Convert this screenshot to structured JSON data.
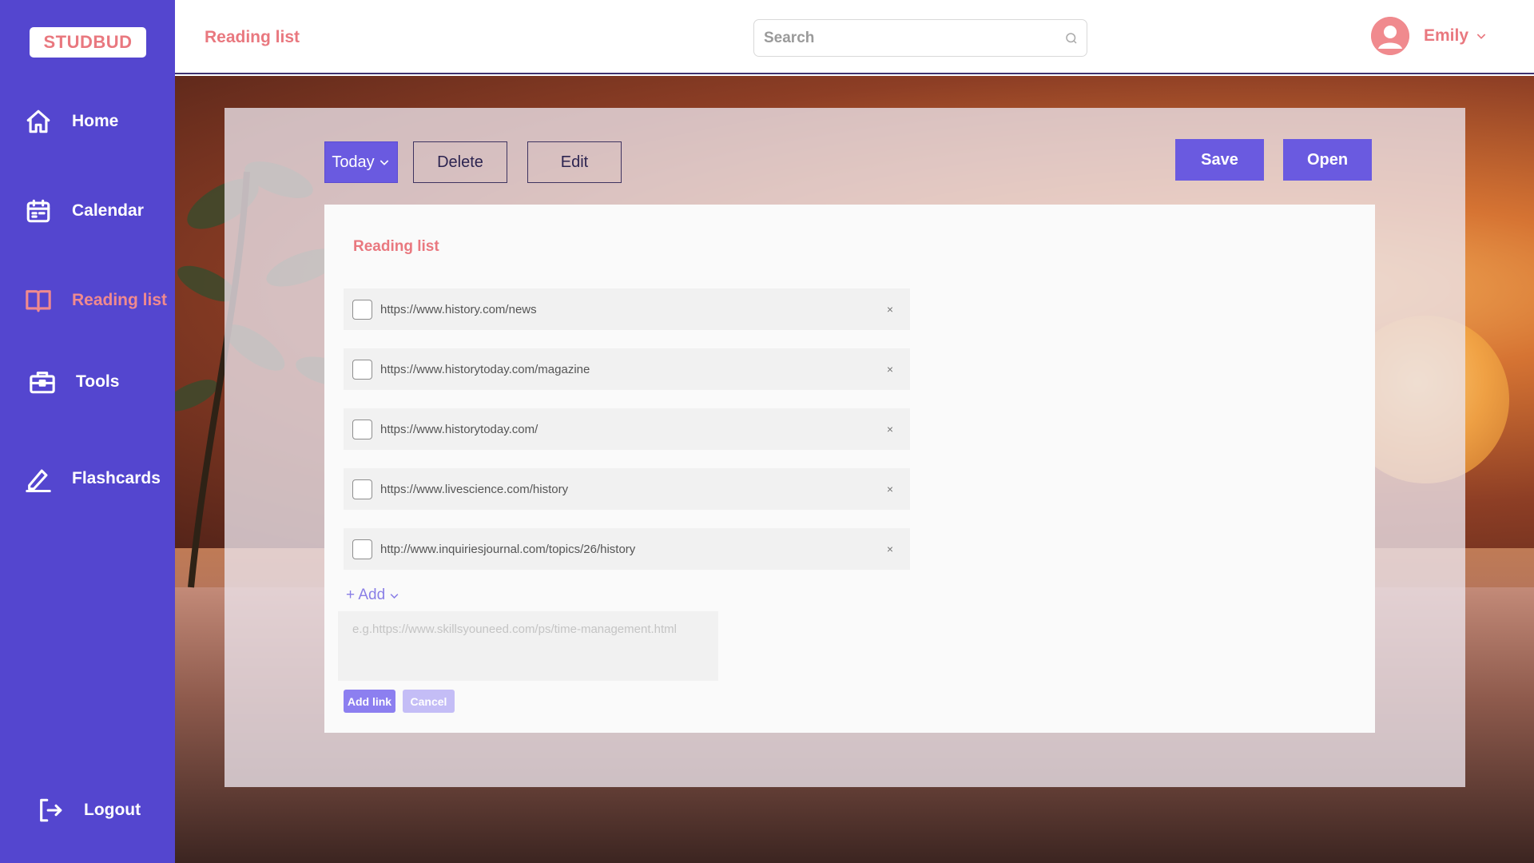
{
  "app": {
    "logo": "STUDBUD"
  },
  "sidebar": {
    "items": [
      {
        "label": "Home",
        "icon": "home-icon"
      },
      {
        "label": "Calendar",
        "icon": "calendar-icon"
      },
      {
        "label": "Reading list",
        "icon": "book-icon",
        "active": true
      },
      {
        "label": "Tools",
        "icon": "toolbox-icon"
      },
      {
        "label": "Flashcards",
        "icon": "pencil-icon"
      }
    ],
    "logout": {
      "label": "Logout",
      "icon": "logout-icon"
    }
  },
  "header": {
    "title": "Reading list",
    "search_placeholder": "Search",
    "user_name": "Emily"
  },
  "toolbar": {
    "today_label": "Today",
    "delete_label": "Delete",
    "edit_label": "Edit",
    "save_label": "Save",
    "open_label": "Open"
  },
  "card": {
    "title": "Reading list",
    "links": [
      {
        "url": "https://www.history.com/news",
        "checked": false
      },
      {
        "url": "https://www.historytoday.com/magazine",
        "checked": false
      },
      {
        "url": "https://www.historytoday.com/",
        "checked": false
      },
      {
        "url": "https://www.livescience.com/history",
        "checked": false
      },
      {
        "url": "http://www.inquiriesjournal.com/topics/26/history",
        "checked": false
      }
    ],
    "remove_glyph": "×",
    "add_toggle_label": "+ Add",
    "input_placeholder": "e.g.https://www.skillsyouneed.com/ps/time-management.html",
    "add_link_label": "Add link",
    "cancel_label": "Cancel"
  },
  "colors": {
    "sidebar": "#5446cf",
    "accent": "#e9787f",
    "primary_button": "#6a5ae0"
  }
}
